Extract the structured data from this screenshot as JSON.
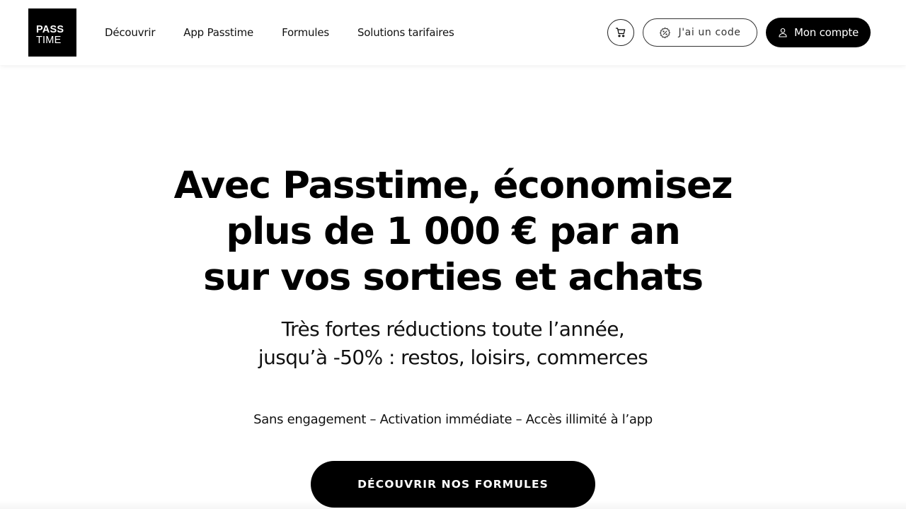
{
  "header": {
    "logo": {
      "line1": "PASS",
      "line2": "TIME"
    },
    "nav": [
      {
        "label": "Découvrir"
      },
      {
        "label": "App Passtime"
      },
      {
        "label": "Formules"
      },
      {
        "label": "Solutions tarifaires"
      }
    ],
    "cart_icon": "cart-icon",
    "code_button": {
      "label": "J'ai un code",
      "icon": "badge-percent-icon"
    },
    "account_button": {
      "label": "Mon compte",
      "icon": "user-icon"
    }
  },
  "hero": {
    "title_lines": [
      "Avec Passtime, économisez",
      "plus de 1 000 € par an",
      "sur vos sorties et achats"
    ],
    "subtitle_lines": [
      "Très fortes réductions toute l’année,",
      "jusqu’à -50% : restos, loisirs, commerces"
    ],
    "tagline": "Sans engagement – Activation immédiate – Accès illimité à l’app",
    "cta_label": "DÉCOUVRIR NOS FORMULES"
  },
  "colors": {
    "primary": "#000000",
    "background": "#ffffff",
    "text": "#111111"
  }
}
